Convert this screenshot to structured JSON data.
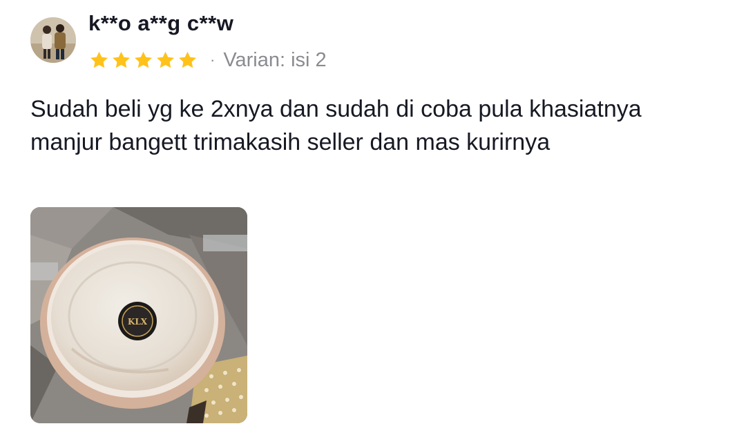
{
  "review": {
    "username": "k**o a**g c**w",
    "rating": 5,
    "rating_max": 5,
    "separator": "·",
    "variant": "Varian: isi 2",
    "text": "Sudah beli yg ke 2xnya dan sudah di coba pula khasiatnya manjur bangett trimakasih seller dan mas kurirnya",
    "photo": {
      "subject": "round-container-with-lid-photo",
      "lid_logo_text": "KLX"
    }
  },
  "colors": {
    "star": "#FFC21A",
    "username": "#161823",
    "meta_gray": "#8A8B91",
    "body_text": "#161823"
  },
  "icons": {
    "star": "star-icon",
    "avatar": "user-avatar"
  }
}
